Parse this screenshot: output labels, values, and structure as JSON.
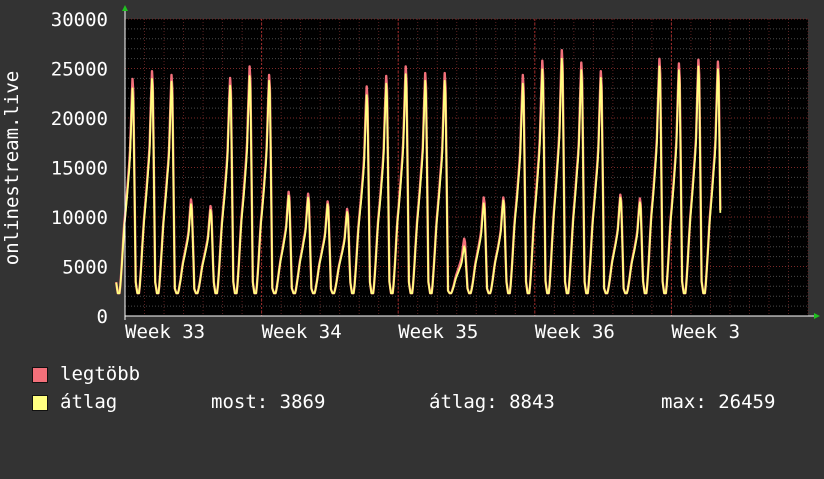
{
  "chart_data": {
    "type": "line",
    "ylabel": "onlinestream.live",
    "ylim": [
      0,
      30000
    ],
    "yticks": [
      0,
      5000,
      10000,
      15000,
      20000,
      25000,
      30000
    ],
    "xlim_days": [
      0,
      35
    ],
    "xticks": [
      {
        "label": "Week 33",
        "day": 0
      },
      {
        "label": "Week 34",
        "day": 7
      },
      {
        "label": "Week 35",
        "day": 14
      },
      {
        "label": "Week 36",
        "day": 21
      },
      {
        "label": "Week 3",
        "day": 28
      }
    ],
    "grid": true,
    "series": [
      {
        "name": "legtöbb",
        "color": "#f2707a",
        "daily_peaks": [
          24700,
          25500,
          25100,
          12100,
          11400,
          24800,
          26000,
          25100,
          12900,
          12700,
          11900,
          11100,
          23900,
          25000,
          26000,
          25300,
          25300,
          8000,
          12300,
          12300,
          25100,
          26600,
          27700,
          26400,
          25500,
          12600,
          12200,
          26800,
          26300,
          26700,
          26500
        ]
      },
      {
        "name": "átlag",
        "color": "#ffff80",
        "daily_peaks": [
          23700,
          24700,
          24400,
          11600,
          11000,
          24000,
          25000,
          24500,
          12500,
          12300,
          11600,
          10800,
          23000,
          24200,
          25200,
          24500,
          24500,
          7200,
          11700,
          12000,
          24200,
          25700,
          26800,
          25600,
          24800,
          12300,
          11800,
          26000,
          25600,
          26000,
          25700
        ]
      }
    ]
  },
  "legend": {
    "max_label": "legtöbb",
    "avg_label": "átlag"
  },
  "stats": {
    "now": "most: 3869",
    "avg": "átlag: 8843",
    "max": "max: 26459"
  }
}
